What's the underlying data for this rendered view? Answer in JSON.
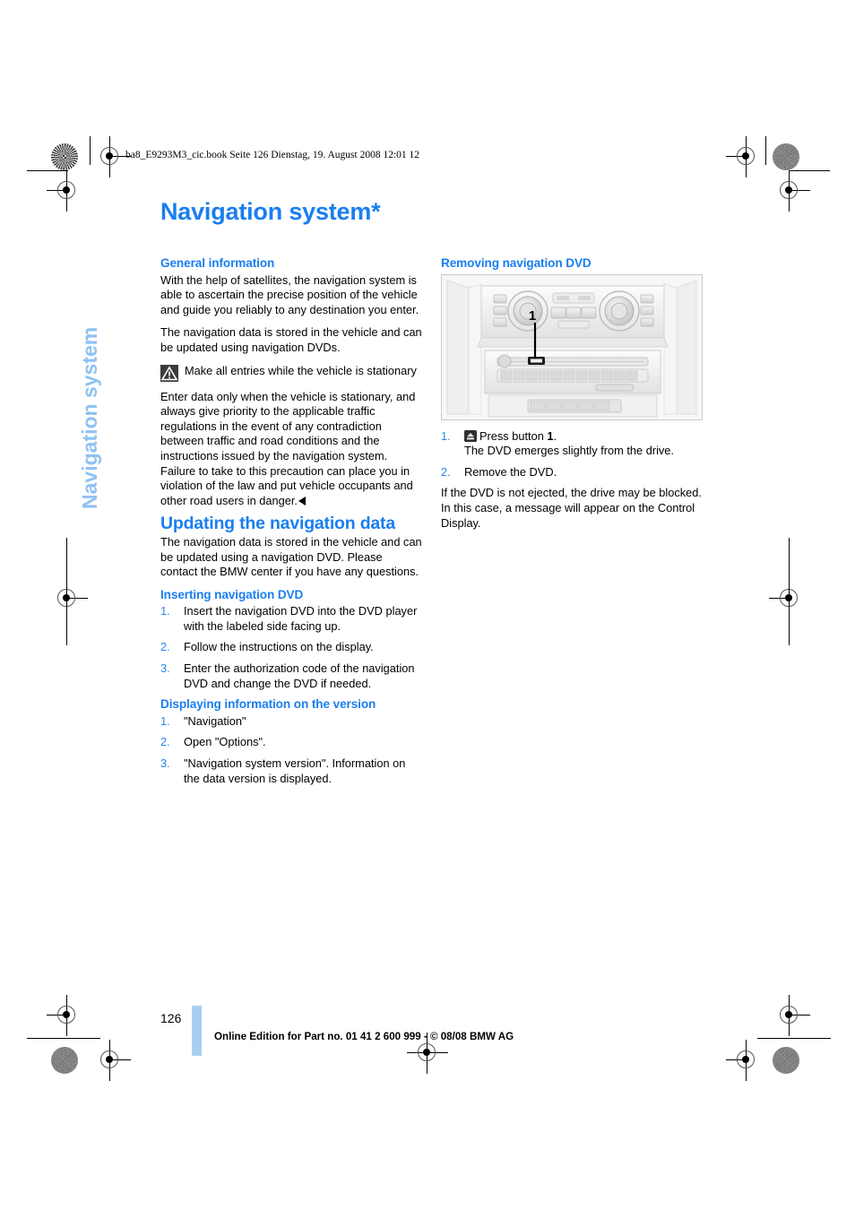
{
  "print_marks": {
    "header_meta": "ba8_E9293M3_cic.book  Seite 126  Dienstag, 19. August 2008  12:01 12"
  },
  "sidebar": {
    "tab_label": "Navigation system"
  },
  "page": {
    "chapter_title": "Navigation system*",
    "page_number": "126",
    "footer_line": "Online Edition for Part no. 01 41 2 600 999 - © 08/08 BMW AG"
  },
  "left_column": {
    "general": {
      "heading": "General information",
      "p1": "With the help of satellites, the navigation system is able to ascertain the precise position of the vehicle and guide you reliably to any destination you enter.",
      "p2": "The navigation data is stored in the vehicle and can be updated using navigation DVDs.",
      "note": "Make all entries while the vehicle is stationary",
      "p3": "Enter data only when the vehicle is stationary, and always give priority to the applicable traffic regulations in the event of any contradiction between traffic and road conditions and the instructions issued by the navigation system. Failure to take to this precaution can place you in violation of the law and put vehicle occupants and other road users in danger."
    },
    "updating": {
      "heading": "Updating the navigation data",
      "p1": "The navigation data is stored in the vehicle and can be updated using a navigation DVD. Please contact the BMW center if you have any questions."
    },
    "inserting": {
      "heading": "Inserting navigation DVD",
      "steps": [
        {
          "num": "1.",
          "text": "Insert the navigation DVD into the DVD player with the labeled side facing up."
        },
        {
          "num": "2.",
          "text": "Follow the instructions on the display."
        },
        {
          "num": "3.",
          "text": "Enter the authorization code of the navigation DVD and change the DVD if needed."
        }
      ]
    },
    "version_info": {
      "heading": "Displaying information on the version",
      "steps": [
        {
          "num": "1.",
          "text": "\"Navigation\""
        },
        {
          "num": "2.",
          "text": "Open \"Options\"."
        },
        {
          "num": "3.",
          "text": "\"Navigation system version\". Information on the data version is displayed."
        }
      ]
    }
  },
  "right_column": {
    "removing": {
      "heading": "Removing navigation DVD",
      "figure": {
        "alt": "center-console-illustration",
        "callout_label": "1"
      },
      "step1_num": "1.",
      "step1_icon": "eject-button-icon",
      "step1_text_a": "Press button ",
      "step1_bold": "1",
      "step1_text_b": ".",
      "step1_sub": "The DVD emerges slightly from the drive.",
      "step2_num": "2.",
      "step2_text": "Remove the DVD.",
      "p_after": "If the DVD is not ejected, the drive may be blocked. In this case, a message will appear on the Control Display."
    }
  },
  "colors": {
    "heading_blue": "#1a7ef0",
    "step_number_blue": "#2b86ee",
    "tab_blue": "#8fc2f2",
    "page_bar_blue": "#a8cff2"
  }
}
